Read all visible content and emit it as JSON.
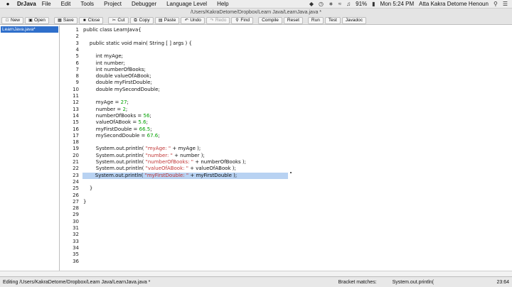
{
  "menubar": {
    "app": "DrJava",
    "items": [
      "File",
      "Edit",
      "Tools",
      "Project",
      "Debugger",
      "Language Level",
      "Help"
    ],
    "battery": "91%",
    "clock": "Mon 5:24 PM",
    "user": "Atta Kakra Detome Henoun"
  },
  "window": {
    "title": "/Users/KakraDetome/Dropbox/Learn Java/LearnJava.java *"
  },
  "toolbar": {
    "new": "New",
    "open": "Open",
    "save": "Save",
    "close": "Close",
    "cut": "Cut",
    "copy": "Copy",
    "paste": "Paste",
    "undo": "Undo",
    "redo": "Redo",
    "find": "Find",
    "compile": "Compile",
    "reset": "Reset",
    "run": "Run",
    "test": "Test",
    "javadoc": "Javadoc"
  },
  "files": [
    "LearnJava.java*"
  ],
  "editor": {
    "line_numbers": [
      "1",
      "2",
      "3",
      "4",
      "5",
      "6",
      "7",
      "8",
      "9",
      "10",
      "11",
      "12",
      "13",
      "14",
      "15",
      "16",
      "17",
      "18",
      "19",
      "20",
      "21",
      "22",
      "23",
      "24",
      "25",
      "26",
      "27",
      "28",
      "29",
      "30",
      "31",
      "32",
      "33",
      "34",
      "35",
      "36"
    ],
    "lines": [
      {
        "t": "public class LearnJava{"
      },
      {
        "t": ""
      },
      {
        "t": "    public static void main( String [ ] args ) {"
      },
      {
        "t": ""
      },
      {
        "t": "        int myAge;"
      },
      {
        "t": "        int number;"
      },
      {
        "t": "        int numberOfBooks;"
      },
      {
        "t": "        double valueOfABook;"
      },
      {
        "t": "        double myFirstDouble;"
      },
      {
        "t": "        double mySecondDouble;"
      },
      {
        "t": ""
      },
      {
        "a": "        myAge = ",
        "n": "27",
        "b": ";"
      },
      {
        "a": "        number = ",
        "n": "2",
        "b": ";"
      },
      {
        "a": "        numberOfBooks = ",
        "n": "56",
        "b": ";"
      },
      {
        "a": "        valueOfABook = ",
        "n": "5.6",
        "b": ";"
      },
      {
        "a": "        myFirstDouble = ",
        "n": "66.5",
        "b": ";"
      },
      {
        "a": "        mySecondDouble = ",
        "n": "67.6",
        "b": ";"
      },
      {
        "t": ""
      },
      {
        "a": "        System.out.println( ",
        "s": "\"myAge: \"",
        "b": " + myAge );"
      },
      {
        "a": "        System.out.println( ",
        "s": "\"number: \"",
        "b": " + number );"
      },
      {
        "a": "        System.out.println( ",
        "s": "\"numberOfBooks: \"",
        "b": " + numberOfBooks );"
      },
      {
        "a": "        System.out.println( ",
        "s": "\"valueOfABook: \"",
        "b": " + valueOfABook );"
      },
      {
        "a": "        System.out.println( ",
        "s": "\"myFirstDouble: \"",
        "b": " + myFirstDouble );",
        "sel": true
      },
      {
        "t": ""
      },
      {
        "t": "    }"
      },
      {
        "t": ""
      },
      {
        "t": "}"
      },
      {
        "t": ""
      },
      {
        "t": ""
      },
      {
        "t": ""
      },
      {
        "t": ""
      },
      {
        "t": ""
      },
      {
        "t": ""
      },
      {
        "t": ""
      },
      {
        "t": ""
      },
      {
        "t": ""
      }
    ]
  },
  "status": {
    "editing": "Editing /Users/KakraDetome/Dropbox/Learn Java/LearnJava.java *",
    "bracket_label": "Bracket matches:",
    "bracket_value": "System.out.println(",
    "position": "23:64"
  }
}
